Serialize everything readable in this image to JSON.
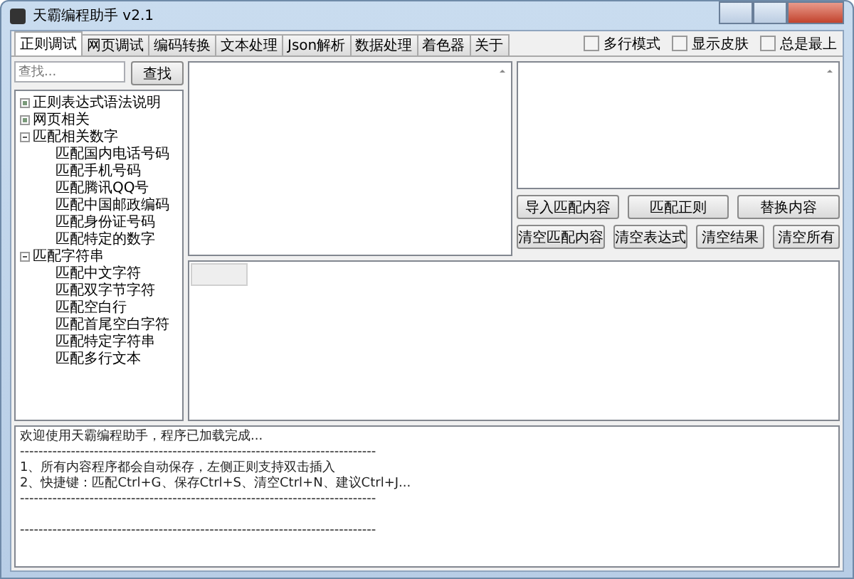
{
  "window": {
    "title": "天霸编程助手 v2.1"
  },
  "tabs": [
    {
      "label": "正则调试",
      "selected": true
    },
    {
      "label": "网页调试",
      "selected": false
    },
    {
      "label": "编码转换",
      "selected": false
    },
    {
      "label": "文本处理",
      "selected": false
    },
    {
      "label": "Json解析",
      "selected": false
    },
    {
      "label": "数据处理",
      "selected": false
    },
    {
      "label": "着色器",
      "selected": false
    },
    {
      "label": "关于",
      "selected": false
    }
  ],
  "options": [
    {
      "label": "多行模式",
      "checked": false
    },
    {
      "label": "显示皮肤",
      "checked": false
    },
    {
      "label": "总是最上",
      "checked": false
    }
  ],
  "search": {
    "placeholder": "查找...",
    "button": "查找"
  },
  "tree": [
    {
      "label": "正则表达式语法说明",
      "expanded": false
    },
    {
      "label": "网页相关",
      "expanded": false
    },
    {
      "label": "匹配相关数字",
      "expanded": true,
      "children": [
        {
          "label": "匹配国内电话号码"
        },
        {
          "label": "匹配手机号码"
        },
        {
          "label": "匹配腾讯QQ号"
        },
        {
          "label": "匹配中国邮政编码"
        },
        {
          "label": "匹配身份证号码"
        },
        {
          "label": "匹配特定的数字"
        }
      ]
    },
    {
      "label": "匹配字符串",
      "expanded": true,
      "children": [
        {
          "label": "匹配中文字符"
        },
        {
          "label": "匹配双字节字符"
        },
        {
          "label": "匹配空白行"
        },
        {
          "label": "匹配首尾空白字符"
        },
        {
          "label": "匹配特定字符串"
        },
        {
          "label": "匹配多行文本"
        }
      ]
    }
  ],
  "buttons_row_1": [
    "导入匹配内容",
    "匹配正则",
    "替换内容"
  ],
  "buttons_row_2": [
    "清空匹配内容",
    "清空表达式",
    "清空结果",
    "清空所有"
  ],
  "log": [
    {
      "kind": "text",
      "text": "欢迎使用天霸编程助手，程序已加载完成..."
    },
    {
      "kind": "text",
      "text": "-----------------------------------------------------------------------------"
    },
    {
      "kind": "text",
      "text": "1、所有内容程序都会自动保存，左侧正则支持双击插入"
    },
    {
      "kind": "text",
      "text": "2、快捷键：匹配Ctrl+G、保存Ctrl+S、清空Ctrl+N、建议Ctrl+J..."
    },
    {
      "kind": "text",
      "text": "-----------------------------------------------------------------------------"
    },
    {
      "kind": "blank"
    },
    {
      "kind": "text",
      "text": "-----------------------------------------------------------------------------"
    }
  ]
}
